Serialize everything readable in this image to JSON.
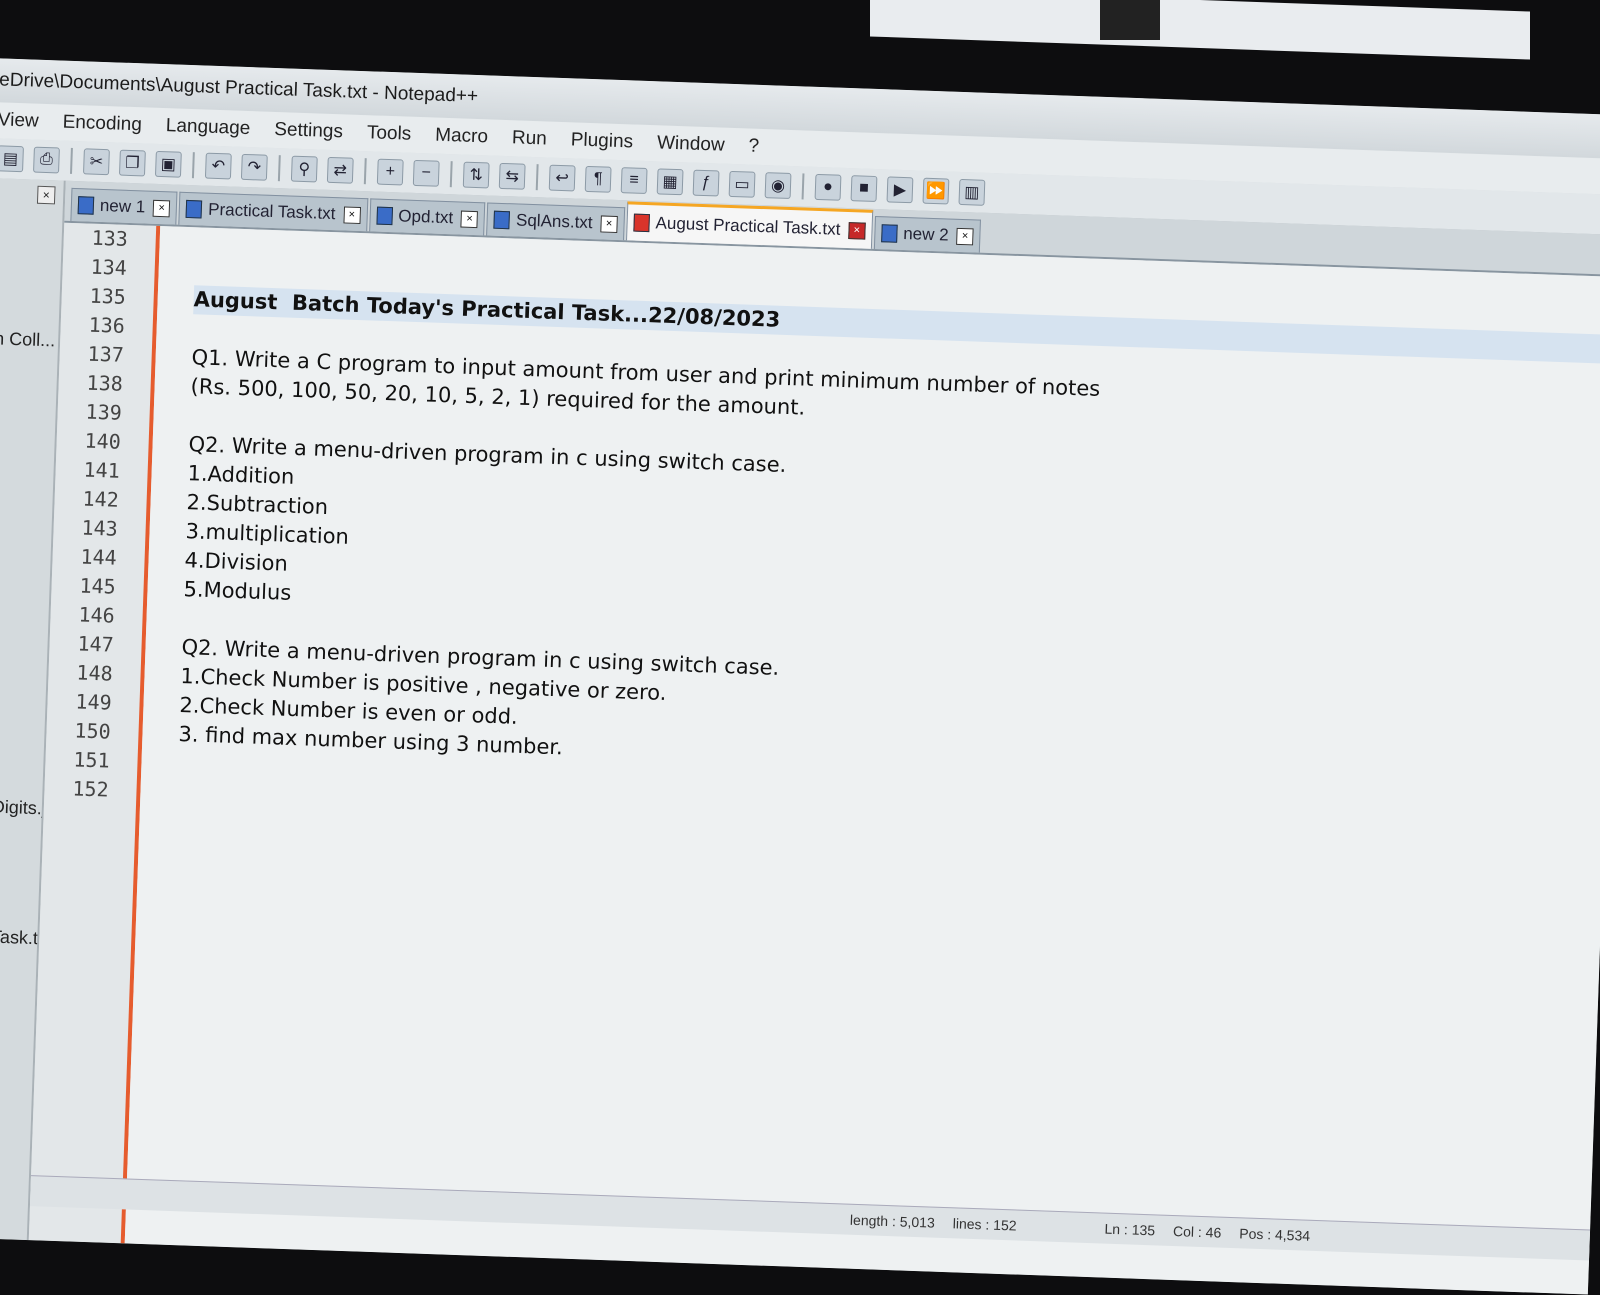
{
  "window": {
    "title": "eDrive\\Documents\\August Practical Task.txt - Notepad++"
  },
  "menu": [
    "View",
    "Encoding",
    "Language",
    "Settings",
    "Tools",
    "Macro",
    "Run",
    "Plugins",
    "Window",
    "?"
  ],
  "toolbar": {
    "icons": [
      "save-icon",
      "print-icon",
      "cut-icon",
      "copy-icon",
      "paste-icon",
      "undo-icon",
      "redo-icon",
      "find-icon",
      "replace-icon",
      "zoom-in-icon",
      "zoom-out-icon",
      "sync-v-icon",
      "sync-h-icon",
      "word-wrap-icon",
      "show-all-chars-icon",
      "indent-guide-icon",
      "doc-map-icon",
      "function-list-icon",
      "folder-workspace-icon",
      "monitor-icon",
      "record-macro-icon",
      "stop-macro-icon",
      "play-macro-icon",
      "run-macro-multiple-icon",
      "save-macro-icon"
    ]
  },
  "side_panel": {
    "items": [
      "en Coll...",
      "astDigits.j...",
      "txt",
      "cal Task.txt"
    ]
  },
  "tabs": [
    {
      "label": "new 1",
      "active": false
    },
    {
      "label": "Practical Task.txt",
      "active": false
    },
    {
      "label": "Opd.txt",
      "active": false
    },
    {
      "label": "SqlAns.txt",
      "active": false
    },
    {
      "label": "August Practical Task.txt",
      "active": true
    },
    {
      "label": "new 2",
      "active": false
    }
  ],
  "editor": {
    "lines": [
      {
        "n": "133",
        "text": ""
      },
      {
        "n": "134",
        "text": ""
      },
      {
        "n": "135",
        "text": "August  Batch Today's Practical Task...22/08/2023"
      },
      {
        "n": "136",
        "text": ""
      },
      {
        "n": "137",
        "text": "Q1. Write a C program to input amount from user and print minimum number of notes"
      },
      {
        "n": "138",
        "text": "(Rs. 500, 100, 50, 20, 10, 5, 2, 1) required for the amount."
      },
      {
        "n": "139",
        "text": ""
      },
      {
        "n": "140",
        "text": "Q2. Write a menu-driven program in c using switch case."
      },
      {
        "n": "141",
        "text": "1.Addition"
      },
      {
        "n": "142",
        "text": "2.Subtraction"
      },
      {
        "n": "143",
        "text": "3.multiplication"
      },
      {
        "n": "144",
        "text": "4.Division"
      },
      {
        "n": "145",
        "text": "5.Modulus"
      },
      {
        "n": "146",
        "text": ""
      },
      {
        "n": "147",
        "text": "Q2. Write a menu-driven program in c using switch case."
      },
      {
        "n": "148",
        "text": "1.Check Number is positive , negative or zero."
      },
      {
        "n": "149",
        "text": "2.Check Number is even or odd."
      },
      {
        "n": "150",
        "text": "3. find max number using 3 number."
      },
      {
        "n": "151",
        "text": ""
      },
      {
        "n": "152",
        "text": ""
      }
    ],
    "current_line": "135"
  },
  "status": {
    "length": "length : 5,013",
    "lines": "lines : 152",
    "ln": "Ln : 135",
    "col": "Col : 46",
    "pos": "Pos : 4,534"
  }
}
